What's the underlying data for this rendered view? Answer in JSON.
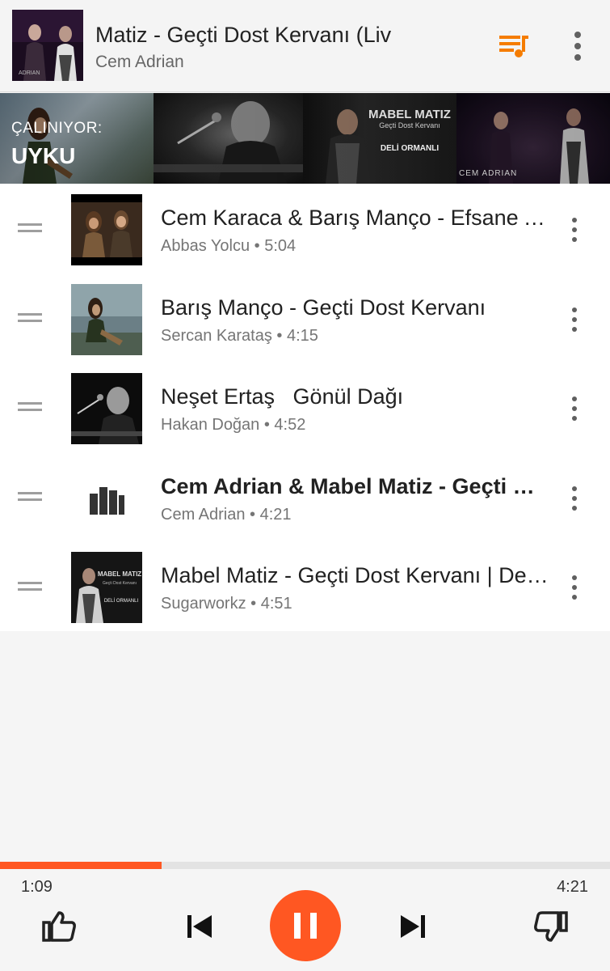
{
  "header": {
    "title": "Matiz - Geçti Dost Kervanı (Liv",
    "artist": "Cem Adrian"
  },
  "banner": {
    "now_playing_label": "ÇALINIYOR:",
    "station_name": "UYKU",
    "logo_line1": "MABEL MATIZ",
    "logo_line2": "Geçti Dost Kervanı",
    "logo_line3": "DELİ ORMANLI",
    "logo_cem": "CEM ADRIAN"
  },
  "queue": [
    {
      "title": "Cem Karaca & Barış Manço - Efsane Arkadaşlık",
      "subtitle": "Abbas Yolcu • 5:04"
    },
    {
      "title": "Barış Manço - Geçti Dost Kervanı",
      "subtitle": "Sercan Karataş • 4:15"
    },
    {
      "title": "Neşet Ertaş   Gönül Dağı",
      "subtitle": "Hakan Doğan • 4:52"
    },
    {
      "title": "Cem Adrian & Mabel Matiz - Geçti Dost Kervanı",
      "subtitle": "Cem Adrian • 4:21",
      "playing": true
    },
    {
      "title": "Mabel Matiz - Geçti Dost Kervanı | Deli Ormanlı",
      "subtitle": "Sugarworkz • 4:51",
      "thumb_text1": "MABEL MATIZ",
      "thumb_text2": "Geçti Dost Kervanı",
      "thumb_text3": "DELİ ORMANLI"
    }
  ],
  "player": {
    "current_time": "1:09",
    "total_time": "4:21",
    "progress": 0.265
  },
  "colors": {
    "accent": "#ff5722",
    "queue_icon": "#f57c00"
  },
  "icons": [
    "queue-music-icon",
    "more-vert-icon",
    "drag-handle-icon",
    "equalizer-icon",
    "thumb-up-icon",
    "skip-previous-icon",
    "pause-icon",
    "skip-next-icon",
    "thumb-down-icon"
  ]
}
